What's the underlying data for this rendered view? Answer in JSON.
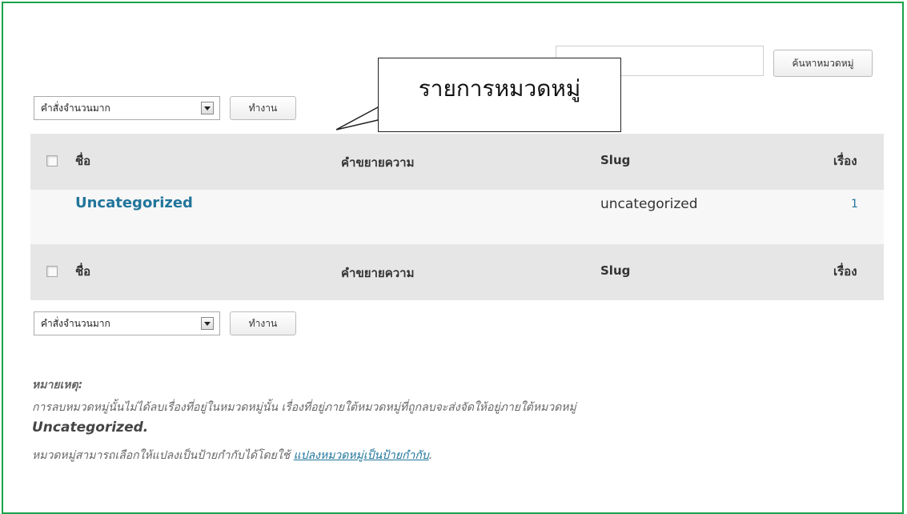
{
  "search": {
    "button_label": "ค้นหาหมวดหมู่",
    "placeholder": ""
  },
  "callout": {
    "text": "รายการหมวดหมู่"
  },
  "bulk_actions": {
    "top": {
      "select_value": "คำสั่งจำนวนมาก",
      "apply_label": "ทำงาน"
    },
    "bottom": {
      "select_value": "คำสั่งจำนวนมาก",
      "apply_label": "ทำงาน"
    }
  },
  "table": {
    "columns": {
      "name": "ชื่อ",
      "description": "คำขยายความ",
      "slug": "Slug",
      "posts": "เรื่อง"
    },
    "rows": [
      {
        "name": "Uncategorized",
        "description": "",
        "slug": "uncategorized",
        "posts": "1"
      }
    ]
  },
  "notes": {
    "label": "หมายเหตุ:",
    "line1": "การลบหมวดหมู่นั้นไม่ได้ลบเรื่องที่อยู่ในหมวดหมู่นั้น เรื่องที่อยู่ภายใต้หมวดหมู่ที่ถูกลบจะส่งจัดให้อยู่ภายใต้หมวดหมู่",
    "default_category": "Uncategorized",
    "default_suffix": ".",
    "line2_prefix": "หมวดหมู่สามารถเลือกให้แปลงเป็นป้ายกำกับได้โดยใช้ ",
    "line2_link": "แปลงหมวดหมู่เป็นป้ายกำกับ",
    "line2_suffix": "."
  },
  "colors": {
    "frame_border": "#1aa34a",
    "link": "#21759b",
    "header_bg": "#e6e6e6",
    "row_bg": "#f7f7f7"
  }
}
